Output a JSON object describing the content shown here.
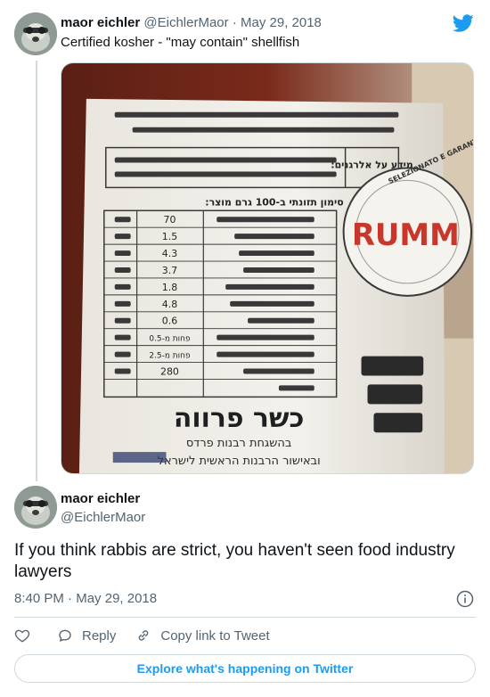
{
  "colors": {
    "accent": "#1d9bf0",
    "text": "#0f1419",
    "muted": "#536471",
    "border": "#cfd9de"
  },
  "quoted_tweet": {
    "author_name": "maor eichler",
    "handle": "@EichlerMaor",
    "separator": "·",
    "date": "May 29, 2018",
    "text": "Certified kosher - \"may contain\" shellfish",
    "image": {
      "kosher_text": "כשר פרווה",
      "kosher_sub1": "בהשגחת רבנות פרדס",
      "kosher_sub2": "ובאישור הרבנות הראשית לישראל",
      "nutrition_title": "סימון תזונתי ב-100 גרם מוצר:",
      "nutrition_values": [
        "70",
        "1.5",
        "4.3",
        "3.7",
        "1.8",
        "4.8",
        "0.6",
        "פחות מ-0.5",
        "פחות מ-2.5",
        "280"
      ],
      "brand": "RUMM",
      "brand_ring": "SELEZIONATO E GARANTITO",
      "allergen_label": "מידע על אלרגנים:"
    }
  },
  "main_tweet": {
    "author_name": "maor eichler",
    "handle": "@EichlerMaor",
    "text": "If you think rabbis are strict, you haven't seen food industry lawyers",
    "time": "8:40 PM",
    "separator": "·",
    "date": "May 29, 2018"
  },
  "actions": {
    "reply_label": "Reply",
    "copy_link_label": "Copy link to Tweet"
  },
  "explore_label": "Explore what's happening on Twitter",
  "icons": {
    "logo": "twitter-bird-icon",
    "like": "heart-icon",
    "reply": "speech-bubble-icon",
    "copy": "link-icon",
    "info": "info-icon"
  }
}
